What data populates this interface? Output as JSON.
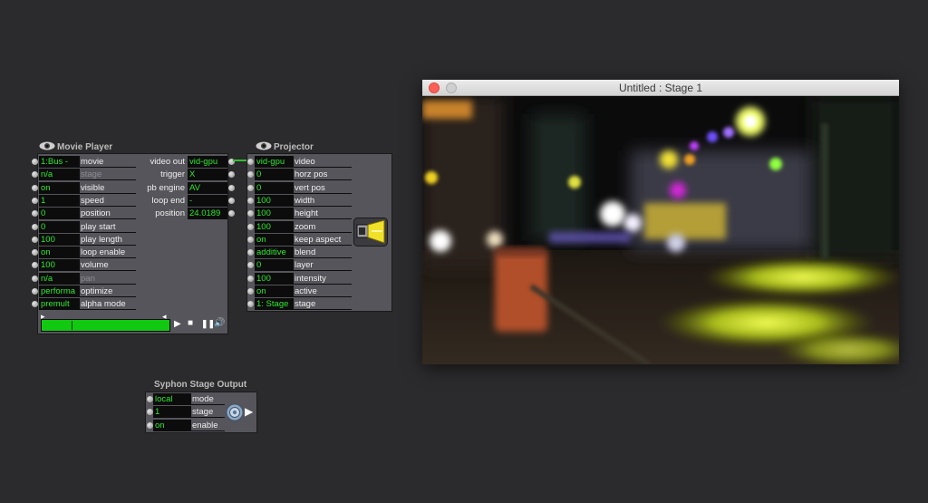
{
  "movie_player": {
    "title": "Movie Player",
    "inputs": [
      {
        "value": "1:Bus -",
        "label": "movie",
        "dim": false
      },
      {
        "value": "n/a",
        "label": "stage",
        "dim": true
      },
      {
        "value": "on",
        "label": "visible",
        "dim": false
      },
      {
        "value": "1",
        "label": "speed",
        "dim": false
      },
      {
        "value": "0",
        "label": "position",
        "dim": false
      },
      {
        "value": "0",
        "label": "play start",
        "dim": false
      },
      {
        "value": "100",
        "label": "play length",
        "dim": false
      },
      {
        "value": "on",
        "label": "loop enable",
        "dim": false
      },
      {
        "value": "100",
        "label": "volume",
        "dim": false
      },
      {
        "value": "n/a",
        "label": "pan",
        "dim": true
      },
      {
        "value": "performa",
        "label": "optimize",
        "dim": false
      },
      {
        "value": "premult",
        "label": "alpha mode",
        "dim": false
      }
    ],
    "outputs": [
      {
        "label": "video out",
        "value": "vid-gpu"
      },
      {
        "label": "trigger",
        "value": "X"
      },
      {
        "label": "pb engine",
        "value": "AV"
      },
      {
        "label": "loop end",
        "value": "-"
      },
      {
        "label": "position",
        "value": "24.0189"
      }
    ],
    "playback_fraction": 0.24
  },
  "projector": {
    "title": "Projector",
    "inputs": [
      {
        "value": "vid-gpu",
        "label": "video"
      },
      {
        "value": "0",
        "label": "horz pos"
      },
      {
        "value": "0",
        "label": "vert pos"
      },
      {
        "value": "100",
        "label": "width"
      },
      {
        "value": "100",
        "label": "height"
      },
      {
        "value": "100",
        "label": "zoom"
      },
      {
        "value": "on",
        "label": "keep aspect"
      },
      {
        "value": "additive",
        "label": "blend"
      },
      {
        "value": "0",
        "label": "layer"
      },
      {
        "value": "100",
        "label": "intensity"
      },
      {
        "value": "on",
        "label": "active"
      },
      {
        "value": "1: Stage",
        "label": "stage"
      }
    ]
  },
  "syphon": {
    "title": "Syphon Stage Output",
    "inputs": [
      {
        "value": "local",
        "label": "mode"
      },
      {
        "value": "1",
        "label": "stage"
      },
      {
        "value": "on",
        "label": "enable"
      }
    ]
  },
  "stage_window": {
    "title": "Untitled : Stage 1"
  },
  "colors": {
    "value_text": "#2ee82e",
    "cable": "#2fbf2f",
    "background": "#2b2b2d",
    "panel": "#55555b"
  }
}
